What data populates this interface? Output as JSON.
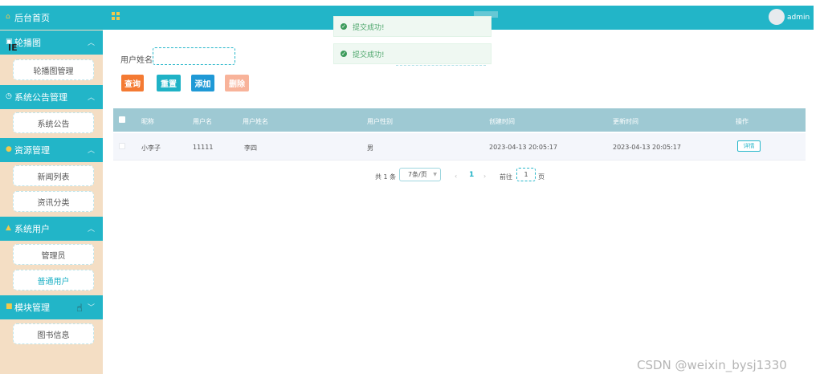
{
  "sidebar": {
    "home": "后台首页",
    "sections": [
      {
        "label": "轮播图",
        "items": [
          "轮播图管理"
        ]
      },
      {
        "label": "系统公告管理",
        "items": [
          "系统公告"
        ]
      },
      {
        "label": "资源管理",
        "items": [
          "新闻列表",
          "资讯分类"
        ]
      },
      {
        "label": "系统用户",
        "items": [
          "管理员",
          "普通用户"
        ]
      },
      {
        "label": "模块管理",
        "items": [
          "图书信息"
        ]
      }
    ],
    "stray_text": "IE"
  },
  "header": {
    "user": "admin"
  },
  "toasts": [
    "提交成功!",
    "提交成功!"
  ],
  "search": {
    "label": "用户姓名",
    "value": ""
  },
  "buttons": {
    "query": "查询",
    "reset": "重置",
    "add": "添加",
    "delete": "删除"
  },
  "table": {
    "headers": [
      "昵称",
      "用户名",
      "用户姓名",
      "用户性别",
      "创建时间",
      "更新时间",
      "操作"
    ],
    "rows": [
      {
        "nickname": "小李子",
        "username": "11111",
        "name": "李四",
        "gender": "男",
        "created": "2023-04-13 20:05:17",
        "updated": "2023-04-13 20:05:17",
        "action": "详情"
      }
    ]
  },
  "pagination": {
    "total": "共 1 条",
    "page_size": "7条/页",
    "current": "1",
    "goto_label": "前往",
    "goto_value": "1",
    "page_unit": "页"
  },
  "colors": {
    "teal": "#22b5c8",
    "sidebar_bg": "#f4dec4",
    "query": "#f47a33",
    "add": "#1f99d6",
    "delete": "#f8b39a"
  },
  "watermark": "CSDN @weixin_bysj1330"
}
